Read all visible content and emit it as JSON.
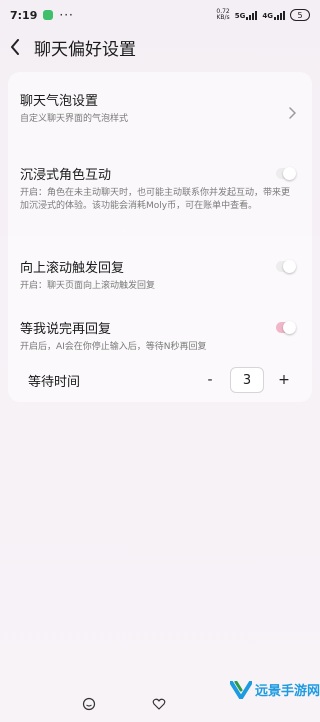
{
  "status_bar": {
    "time": "7:19",
    "net_speed": "0.72",
    "net_unit": "KB/s",
    "signal_5g": "5G",
    "signal_4g": "4G",
    "battery": "5"
  },
  "header": {
    "title": "聊天偏好设置"
  },
  "settings": {
    "bubble": {
      "title": "聊天气泡设置",
      "desc": "自定义聊天界面的气泡样式"
    },
    "immersive": {
      "title": "沉浸式角色互动",
      "desc": "开启：角色在未主动聊天时，也可能主动联系你并发起互动，带来更加沉浸式的体验。该功能会消耗Moly币，可在账单中查看。",
      "enabled": false
    },
    "scroll_reply": {
      "title": "向上滚动触发回复",
      "desc": "开启：聊天页面向上滚动触发回复",
      "enabled": false
    },
    "wait_reply": {
      "title": "等我说完再回复",
      "desc": "开启后，AI会在你停止输入后，等待N秒再回复",
      "enabled": true
    },
    "wait_time": {
      "label": "等待时间",
      "minus": "-",
      "value": "3",
      "plus": "+"
    }
  },
  "watermark": {
    "text": "远景手游网"
  },
  "colors": {
    "toggle_on": "#f0b7c8",
    "toggle_off": "#ededed",
    "watermark": "#1e9be0"
  }
}
